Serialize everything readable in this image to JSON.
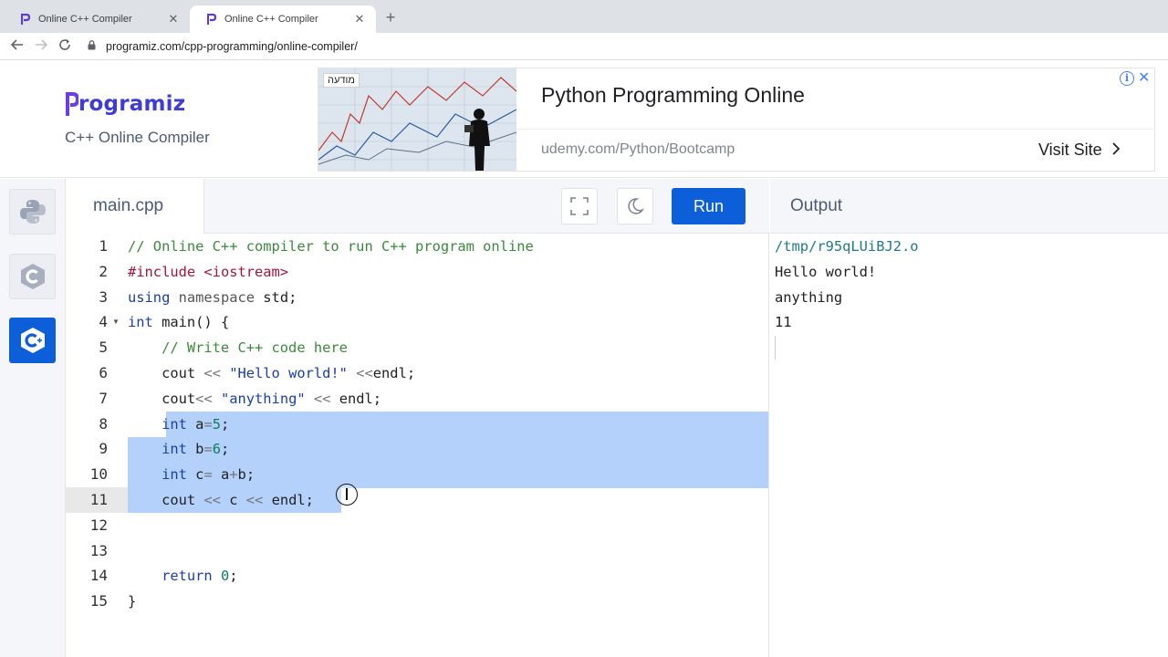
{
  "browser": {
    "tabs": [
      {
        "title": "Online C++ Compiler",
        "active": false
      },
      {
        "title": "Online C++ Compiler",
        "active": true
      }
    ],
    "new_tab_icon": "+",
    "close_icon": "✕",
    "url": "programiz.com/cpp-programming/online-compiler/"
  },
  "header": {
    "logo_text": "rogramiz",
    "subtitle": "C++ Online Compiler"
  },
  "ad": {
    "badge": "מודעה",
    "headline": "Python Programming Online",
    "url": "udemy.com/Python/Bootcamp",
    "cta": "Visit Site",
    "info_icon": "i",
    "close_icon": "✕"
  },
  "languages": [
    {
      "name": "python-icon",
      "active": false
    },
    {
      "name": "c-icon",
      "active": false
    },
    {
      "name": "cpp-icon",
      "active": true
    }
  ],
  "editor": {
    "filename": "main.cpp",
    "run_label": "Run",
    "current_line": 11,
    "line_numbers": [
      "1",
      "2",
      "3",
      "4",
      "5",
      "6",
      "7",
      "8",
      "9",
      "10",
      "11",
      "12",
      "13",
      "14",
      "15"
    ]
  },
  "code_lines": [
    [
      {
        "t": "// Online C++ compiler to run C++ program online",
        "c": "c-com"
      }
    ],
    [
      {
        "t": "#include ",
        "c": "c-pre"
      },
      {
        "t": "<iostream>",
        "c": "c-pre"
      }
    ],
    [
      {
        "t": "using ",
        "c": "c-kw"
      },
      {
        "t": "namespace ",
        "c": "c-ns"
      },
      {
        "t": "std;",
        "c": ""
      }
    ],
    [
      {
        "t": "int ",
        "c": "c-kw"
      },
      {
        "t": "main() {",
        "c": ""
      }
    ],
    [
      {
        "t": "    // Write C++ code here",
        "c": "c-com"
      }
    ],
    [
      {
        "t": "    cout ",
        "c": ""
      },
      {
        "t": "<< ",
        "c": "c-op"
      },
      {
        "t": "\"Hello world!\"",
        "c": "c-str"
      },
      {
        "t": " <<",
        "c": "c-op"
      },
      {
        "t": "endl;",
        "c": ""
      }
    ],
    [
      {
        "t": "    cout",
        "c": ""
      },
      {
        "t": "<< ",
        "c": "c-op"
      },
      {
        "t": "\"anything\"",
        "c": "c-str"
      },
      {
        "t": " << ",
        "c": "c-op"
      },
      {
        "t": "endl;",
        "c": ""
      }
    ],
    [
      {
        "t": "    ",
        "c": ""
      },
      {
        "t": "int ",
        "c": "c-kw"
      },
      {
        "t": "a",
        "c": ""
      },
      {
        "t": "=",
        "c": "c-op"
      },
      {
        "t": "5",
        "c": "c-num"
      },
      {
        "t": ";",
        "c": ""
      }
    ],
    [
      {
        "t": "    ",
        "c": ""
      },
      {
        "t": "int ",
        "c": "c-kw"
      },
      {
        "t": "b",
        "c": ""
      },
      {
        "t": "=",
        "c": "c-op"
      },
      {
        "t": "6",
        "c": "c-num"
      },
      {
        "t": ";",
        "c": ""
      }
    ],
    [
      {
        "t": "    ",
        "c": ""
      },
      {
        "t": "int ",
        "c": "c-kw"
      },
      {
        "t": "c",
        "c": ""
      },
      {
        "t": "= ",
        "c": "c-op"
      },
      {
        "t": "a",
        "c": ""
      },
      {
        "t": "+",
        "c": "c-op"
      },
      {
        "t": "b;",
        "c": ""
      }
    ],
    [
      {
        "t": "    cout ",
        "c": ""
      },
      {
        "t": "<< ",
        "c": "c-op"
      },
      {
        "t": "c ",
        "c": ""
      },
      {
        "t": "<< ",
        "c": "c-op"
      },
      {
        "t": "endl;",
        "c": ""
      }
    ],
    [
      {
        "t": "",
        "c": ""
      }
    ],
    [
      {
        "t": "",
        "c": ""
      }
    ],
    [
      {
        "t": "    return ",
        "c": "c-kw"
      },
      {
        "t": "0",
        "c": "c-num"
      },
      {
        "t": ";",
        "c": ""
      }
    ],
    [
      {
        "t": "}",
        "c": ""
      }
    ]
  ],
  "output": {
    "title": "Output",
    "lines": [
      "/tmp/r95qLUiBJ2.o",
      "Hello world!",
      "anything",
      "11"
    ]
  }
}
